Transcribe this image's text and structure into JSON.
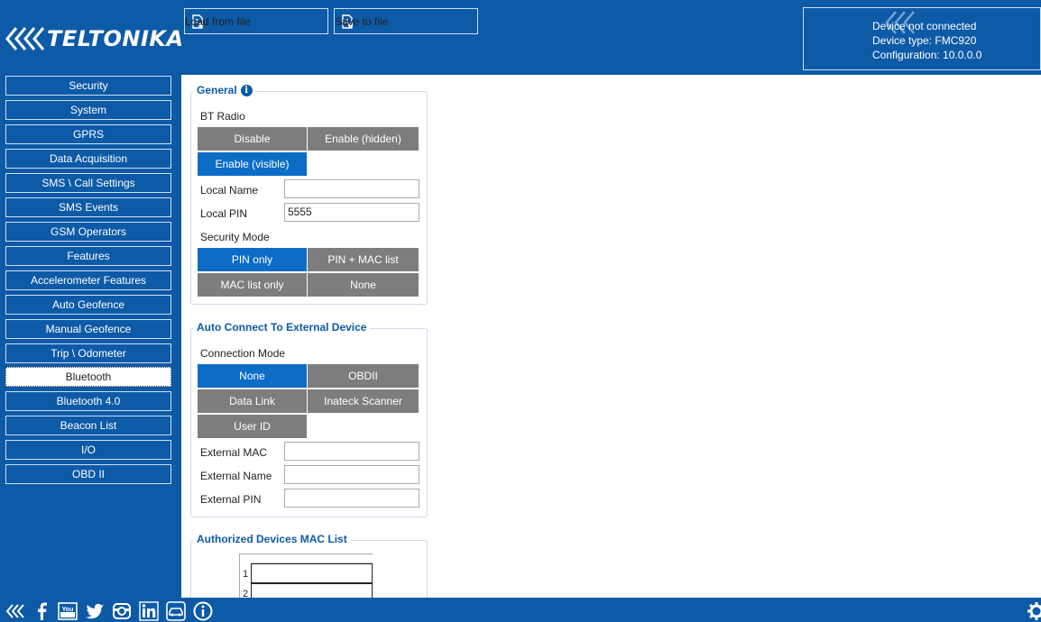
{
  "brand": {
    "name": "TELTONIKA"
  },
  "toolbar": {
    "load_label": "Load from file",
    "save_label": "Save to file"
  },
  "device_status": {
    "connection": "Device not connected",
    "device_type": "Device type: FMC920",
    "configuration": "Configuration: 10.0.0.0"
  },
  "sidebar": {
    "items": [
      {
        "label": "Security"
      },
      {
        "label": "System"
      },
      {
        "label": "GPRS"
      },
      {
        "label": "Data Acquisition"
      },
      {
        "label": "SMS \\ Call Settings"
      },
      {
        "label": "SMS Events"
      },
      {
        "label": "GSM Operators"
      },
      {
        "label": "Features"
      },
      {
        "label": "Accelerometer Features"
      },
      {
        "label": "Auto Geofence"
      },
      {
        "label": "Manual Geofence"
      },
      {
        "label": "Trip \\ Odometer"
      },
      {
        "label": "Bluetooth"
      },
      {
        "label": "Bluetooth 4.0"
      },
      {
        "label": "Beacon List"
      },
      {
        "label": "I/O"
      },
      {
        "label": "OBD II"
      }
    ],
    "active": "Bluetooth"
  },
  "general": {
    "title": "General",
    "bt_radio_label": "BT Radio",
    "bt_radio_options": [
      "Disable",
      "Enable (hidden)",
      "Enable (visible)"
    ],
    "bt_radio_selected": "Enable (visible)",
    "local_name_label": "Local Name",
    "local_name_value": "",
    "local_pin_label": "Local PIN",
    "local_pin_value": "5555",
    "security_mode_label": "Security Mode",
    "security_mode_options": [
      "PIN only",
      "PIN + MAC list",
      "MAC list only",
      "None"
    ],
    "security_mode_selected": "PIN only"
  },
  "auto_connect": {
    "title": "Auto Connect To External Device",
    "connection_mode_label": "Connection Mode",
    "connection_mode_options": [
      "None",
      "OBDII",
      "Data Link",
      "Inateck Scanner",
      "User ID"
    ],
    "connection_mode_selected": "None",
    "external_mac_label": "External MAC",
    "external_mac_value": "",
    "external_name_label": "External Name",
    "external_name_value": "",
    "external_pin_label": "External PIN",
    "external_pin_value": ""
  },
  "authorized": {
    "title": "Authorized Devices MAC List",
    "rows": [
      "1",
      "2"
    ]
  },
  "footer": {
    "icons": [
      "teltonika-icon",
      "facebook-icon",
      "youtube-icon",
      "twitter-icon",
      "instagram-icon",
      "linkedin-icon",
      "car-icon",
      "info-icon",
      "gear-icon"
    ]
  },
  "colors": {
    "header_blue": "#0d5aa7",
    "selected_blue": "#0c6cc6",
    "option_grey": "#7d7d7d"
  }
}
